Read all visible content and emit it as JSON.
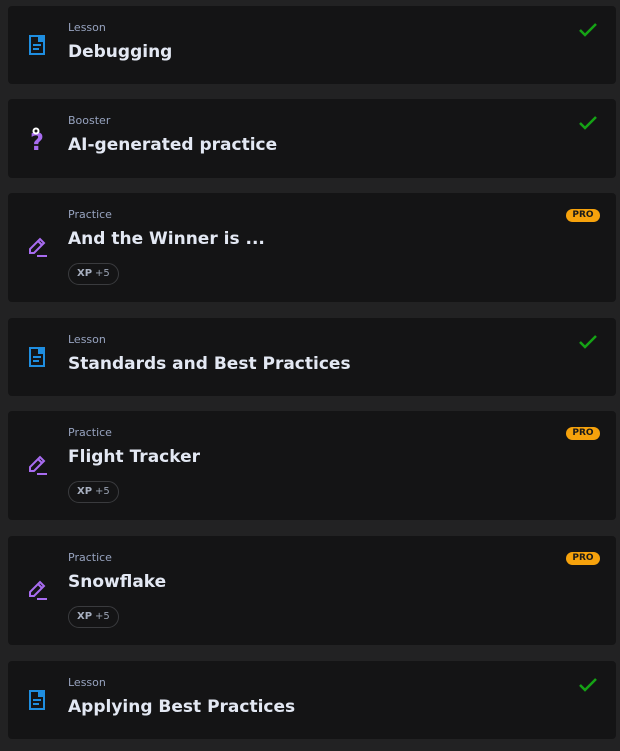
{
  "colors": {
    "lesson_icon": "#1f8ee0",
    "booster_icon": "#a86cf0",
    "practice_icon": "#a86cf0",
    "check": "#15a315",
    "pro_badge": "#f6a20c"
  },
  "items": [
    {
      "type": "Lesson",
      "title": "Debugging",
      "status": "completed",
      "icon": "lesson-icon"
    },
    {
      "type": "Booster",
      "title": "AI-generated practice",
      "status": "completed",
      "icon": "booster-question-icon"
    },
    {
      "type": "Practice",
      "title": "And the Winner is ...",
      "badge": "PRO",
      "xp_label": "XP",
      "xp_value": "+5",
      "icon": "practice-pencil-icon"
    },
    {
      "type": "Lesson",
      "title": "Standards and Best Practices",
      "status": "completed",
      "icon": "lesson-icon"
    },
    {
      "type": "Practice",
      "title": "Flight Tracker",
      "badge": "PRO",
      "xp_label": "XP",
      "xp_value": "+5",
      "icon": "practice-pencil-icon"
    },
    {
      "type": "Practice",
      "title": "Snowflake",
      "badge": "PRO",
      "xp_label": "XP",
      "xp_value": "+5",
      "icon": "practice-pencil-icon"
    },
    {
      "type": "Lesson",
      "title": "Applying Best Practices",
      "status": "completed",
      "icon": "lesson-icon"
    }
  ]
}
